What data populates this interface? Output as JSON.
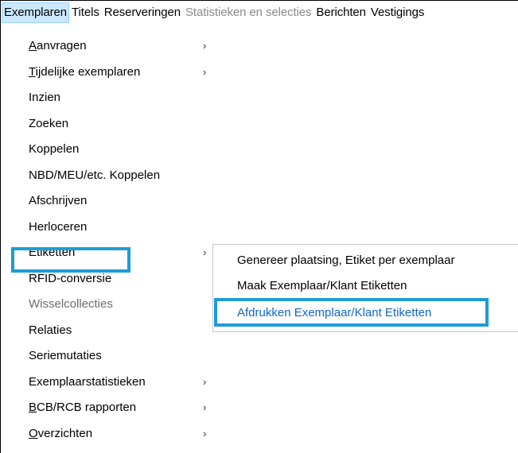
{
  "menubar": {
    "items": [
      {
        "label": "Exemplaren",
        "state": "active"
      },
      {
        "label": "Titels",
        "state": "normal"
      },
      {
        "label": "Reserveringen",
        "state": "normal"
      },
      {
        "label": "Statistieken en selecties",
        "state": "disabled"
      },
      {
        "label": "Berichten",
        "state": "normal"
      },
      {
        "label": "Vestigings",
        "state": "normal"
      }
    ]
  },
  "dropdown": {
    "items": [
      {
        "first": "A",
        "rest": "anvragen",
        "has_submenu": true
      },
      {
        "first": "T",
        "rest": "ijdelijke exemplaren",
        "has_submenu": true
      },
      {
        "label": "Inzien"
      },
      {
        "label": "Zoeken"
      },
      {
        "label": "Koppelen"
      },
      {
        "label": "NBD/MEU/etc. Koppelen"
      },
      {
        "label": "Afschrijven"
      },
      {
        "label": "Herloceren"
      },
      {
        "label": "Etiketten",
        "has_submenu": true,
        "highlighted": true
      },
      {
        "label": "RFID-conversie"
      },
      {
        "label": "Wisselcollecties",
        "disabled": true
      },
      {
        "label": "Relaties"
      },
      {
        "label": "Seriemutaties"
      },
      {
        "label": "Exemplaarstatistieken",
        "has_submenu": true
      },
      {
        "first": "B",
        "rest": "CB/RCB rapporten",
        "has_submenu": true
      },
      {
        "first": "O",
        "rest": "verzichten",
        "has_submenu": true
      }
    ],
    "arrow_glyph": "›"
  },
  "submenu": {
    "items": [
      {
        "label": "Genereer plaatsing, Etiket per exemplaar"
      },
      {
        "label": "Maak Exemplaar/Klant Etiketten"
      },
      {
        "label": "Afdrukken Exemplaar/Klant Etiketten",
        "selected": true
      }
    ]
  },
  "colors": {
    "highlight_border": "#1e9bd8",
    "menubar_active_bg": "#cce8ff",
    "selected_text": "#1066c9",
    "disabled_text": "#8a8a8a"
  }
}
